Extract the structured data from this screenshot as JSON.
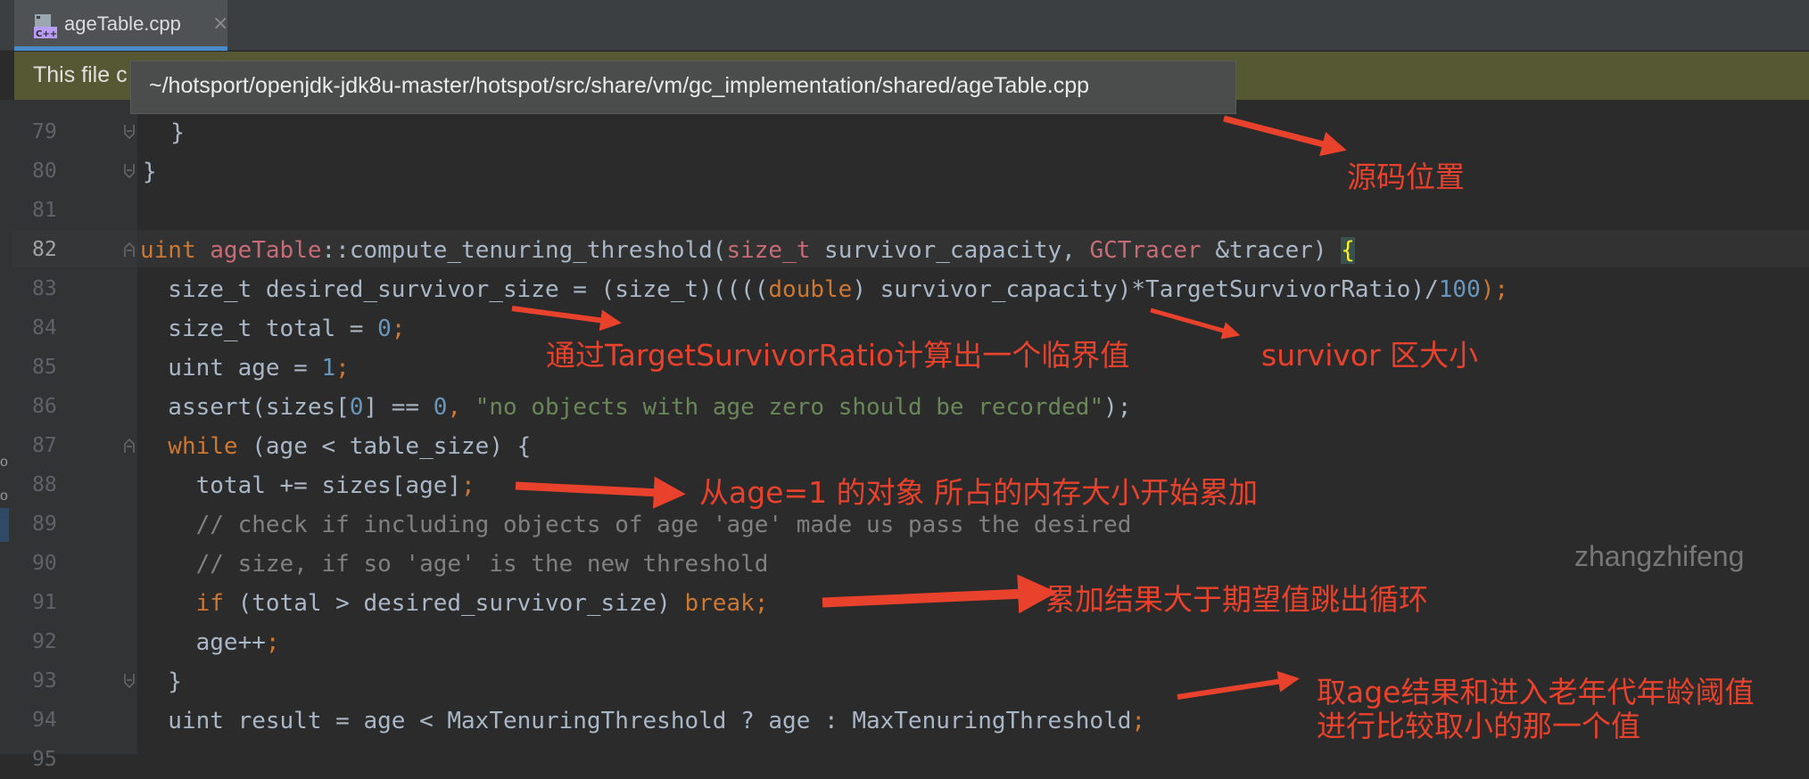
{
  "tab": {
    "label": "ageTable.cpp",
    "close_glyph": "×",
    "icon": "cpp-file-icon"
  },
  "notice": {
    "text": "This file c"
  },
  "tooltip": {
    "path": "~/hotsport/openjdk-jdk8u-master/hotspot/src/share/vm/gc_implementation/shared/ageTable.cpp"
  },
  "lines": [
    {
      "n": "79",
      "tokens": [
        "  }"
      ]
    },
    {
      "n": "80",
      "tokens": [
        "}"
      ]
    },
    {
      "n": "81",
      "tokens": [
        ""
      ]
    },
    {
      "n": "82",
      "current": true
    },
    {
      "n": "83"
    },
    {
      "n": "84"
    },
    {
      "n": "85"
    },
    {
      "n": "86"
    },
    {
      "n": "87"
    },
    {
      "n": "88"
    },
    {
      "n": "89",
      "comment": "    // check if including objects of age 'age' made us pass the desired"
    },
    {
      "n": "90",
      "comment": "    // size, if so 'age' is the new threshold"
    },
    {
      "n": "91"
    },
    {
      "n": "92"
    },
    {
      "n": "93"
    },
    {
      "n": "94"
    },
    {
      "n": "95"
    }
  ],
  "code": {
    "l82": {
      "uint": "uint",
      "ageTable": " ageTable",
      "rest1": "::compute_tenuring_threshold(",
      "size_t": "size_t",
      "p1": " survivor_capacity, ",
      "gctracer": "GCTracer",
      "p2": " &tracer) ",
      "brace": "{"
    },
    "l83": {
      "a": "  size_t desired_survivor_size = (size_t)((((",
      "double": "double",
      "b": ") survivor_capacity)*TargetSurvivorRatio)/",
      "num": "100",
      "c": ");"
    },
    "l84": {
      "a": "  size_t total = ",
      "num": "0",
      "c": ";"
    },
    "l85": {
      "a": "  uint age = ",
      "num": "1",
      "c": ";"
    },
    "l86": {
      "a": "  assert(sizes[",
      "num0": "0",
      "b": "] == ",
      "num1": "0",
      "c": ", ",
      "str": "\"no objects with age zero should be recorded\"",
      "d": ");"
    },
    "l87": {
      "while": "  while",
      "a": " (age < table_size) {"
    },
    "l88": {
      "a": "    total += sizes[age]",
      "semi": ";"
    },
    "l91": {
      "if": "    if",
      "a": " (total > desired_survivor_size) ",
      "break": "break",
      "semi": ";"
    },
    "l92": {
      "a": "    age++",
      "semi": ";"
    },
    "l93": {
      "a": "  }"
    },
    "l94": {
      "a": "  uint result = age < MaxTenuringThreshold ? age : MaxTenuringThreshold",
      "semi": ";"
    }
  },
  "annotations": {
    "source_location": "源码位置",
    "threshold": "通过TargetSurvivorRatio计算出一个临界值",
    "survivor_size": "survivor 区大小",
    "accumulate": "从age=1 的对象 所占的内存大小开始累加",
    "break_loop": "累加结果大于期望值跳出循环",
    "compare_line1": "取age结果和进入老年代年龄阈值",
    "compare_line2": "进行比较取小的那一个值"
  },
  "watermark": "zhangzhifeng",
  "left_strip": {
    "glyph1": "o",
    "glyph2": "o"
  },
  "colors": {
    "annotation": "#e8412c",
    "keyword": "#cc7832",
    "number": "#6897bb",
    "string": "#6a8759",
    "comment": "#808080",
    "type_purple": "#c76b76"
  }
}
